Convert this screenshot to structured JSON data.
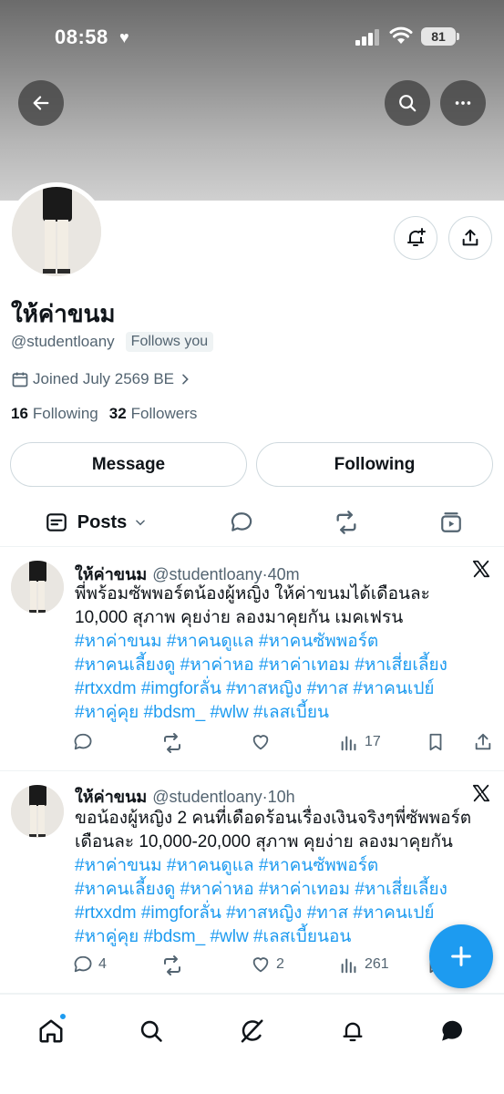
{
  "status_bar": {
    "time": "08:58",
    "battery": "81"
  },
  "profile": {
    "name": "ให้ค่าขนม",
    "handle": "@studentloany",
    "follows_you": "Follows you",
    "joined": "Joined July 2569 BE",
    "following_count": "16",
    "following_label": "Following",
    "followers_count": "32",
    "followers_label": "Followers"
  },
  "actions": {
    "message": "Message",
    "following": "Following"
  },
  "tabs": {
    "posts": "Posts"
  },
  "tweets": [
    {
      "name": "ให้ค่าขนม",
      "handle": "@studentloany",
      "time": "·40m",
      "text_line1": "พี่พร้อมซัพพอร์ตน้องผู้หญิง ให้ค่าขนมได้เดือนละ",
      "text_line2": "10,000 สุภาพ คุยง่าย ลองมาคุยกัน เมคเฟรน",
      "tags_line1": "#หาค่าขนม #หาคนดูแล #หาคนซัพพอร์ต",
      "tags_line2": "#หาคนเลี้ยงดู #หาค่าหอ  #หาค่าเทอม #หาเสี่ยเลี้ยง",
      "tags_line3": "#rtxxdm #imgforลั่น #ทาสหญิง #ทาส #หาคนเปย์",
      "tags_line4": "#หาคู่คุย #bdsm_ #wlw #เลสเบี้ยน",
      "replies": "",
      "reposts": "",
      "likes": "",
      "views": "17"
    },
    {
      "name": "ให้ค่าขนม",
      "handle": "@studentloany",
      "time": "·10h",
      "text_line1": "ขอน้องผู้หญิง 2 คนที่เดือดร้อนเรื่องเงินจริงๆพี่ซัพพอร์ต",
      "text_line2": "เดือนละ 10,000-20,000 สุภาพ คุยง่าย ลองมาคุยกัน",
      "tags_line1": "#หาค่าขนม #หาคนดูแล #หาคนซัพพอร์ต",
      "tags_line2": "#หาคนเลี้ยงดู #หาค่าหอ  #หาค่าเทอม #หาเสี่ยเลี้ยง",
      "tags_line3": "#rtxxdm #imgforลั่น #ทาสหญิง #ทาส #หาคนเปย์",
      "tags_line4": "#หาคู่คุย #bdsm_ #wlw #เลสเบี้ยนอน",
      "replies": "4",
      "reposts": "",
      "likes": "2",
      "views": "261"
    }
  ],
  "colors": {
    "accent": "#1d9bf0",
    "muted": "#536471",
    "text": "#0f1419"
  },
  "icons": [
    "back-arrow-icon",
    "search-icon",
    "more-icon",
    "add-notification-icon",
    "share-icon",
    "calendar-icon",
    "chevron-right-icon",
    "posts-icon",
    "chevron-down-icon",
    "replies-icon",
    "reposts-icon",
    "media-icon",
    "x-logo-icon",
    "reply-icon",
    "repost-icon",
    "like-icon",
    "views-icon",
    "bookmark-icon",
    "compose-icon",
    "home-icon",
    "grok-icon",
    "bell-icon",
    "messages-icon"
  ]
}
